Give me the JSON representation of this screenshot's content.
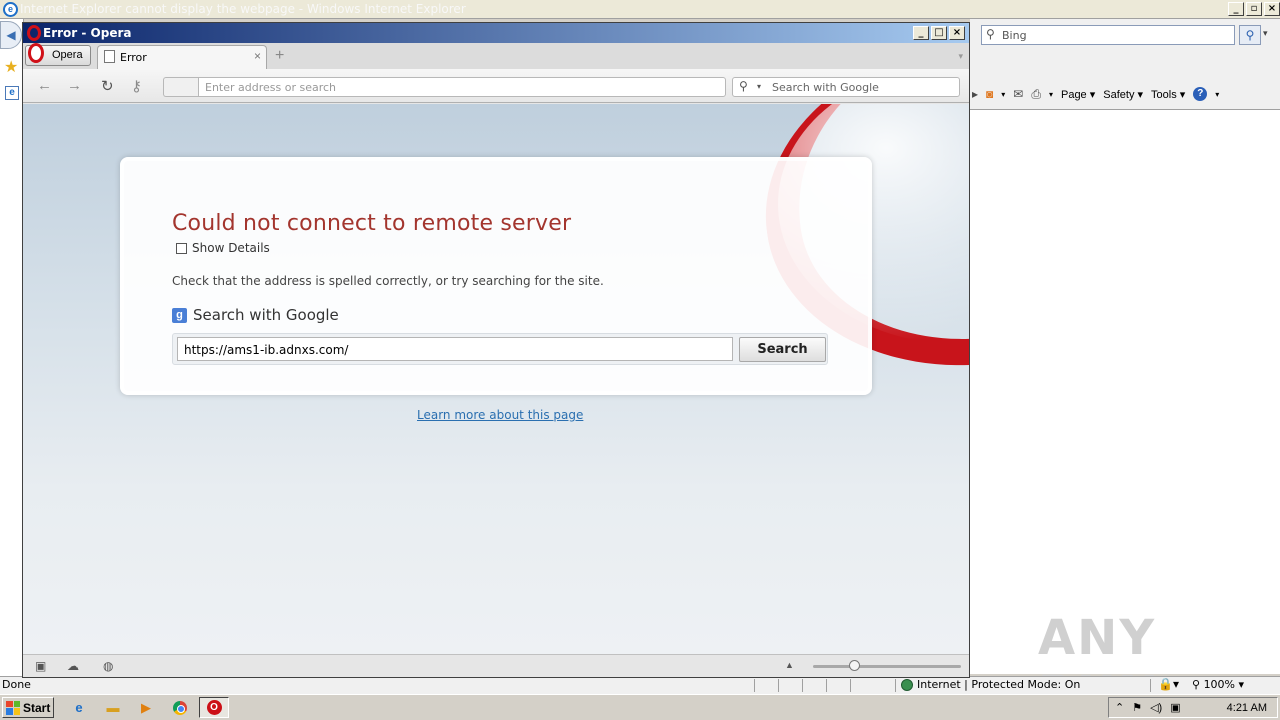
{
  "ie": {
    "title": "Internet Explorer cannot display the webpage - Windows Internet Explorer",
    "search_placeholder": "Bing",
    "commands": {
      "page": "Page",
      "safety": "Safety",
      "tools": "Tools"
    },
    "status": {
      "done": "Done",
      "zone": "Internet | Protected Mode: On",
      "zoom": "100%"
    }
  },
  "opera": {
    "title": "Error - Opera",
    "menu_label": "Opera",
    "tab_label": "Error",
    "address_placeholder": "Enter address or search",
    "search_placeholder": "Search with Google",
    "error": {
      "title": "Could not connect to remote server",
      "show_details": "Show Details",
      "description": "Check that the address is spelled correctly, or try searching for the site.",
      "search_heading": "Search with Google",
      "search_icon_letter": "g",
      "search_value": "https://ams1-ib.adnxs.com/",
      "search_button": "Search",
      "learn_more": "Learn more about this page"
    }
  },
  "taskbar": {
    "start": "Start",
    "clock": "4:21 AM"
  },
  "watermark": "ANY RUN",
  "colors": {
    "error_title": "#a3352e",
    "opera_red": "#c8141b",
    "link": "#2a6fb0"
  }
}
